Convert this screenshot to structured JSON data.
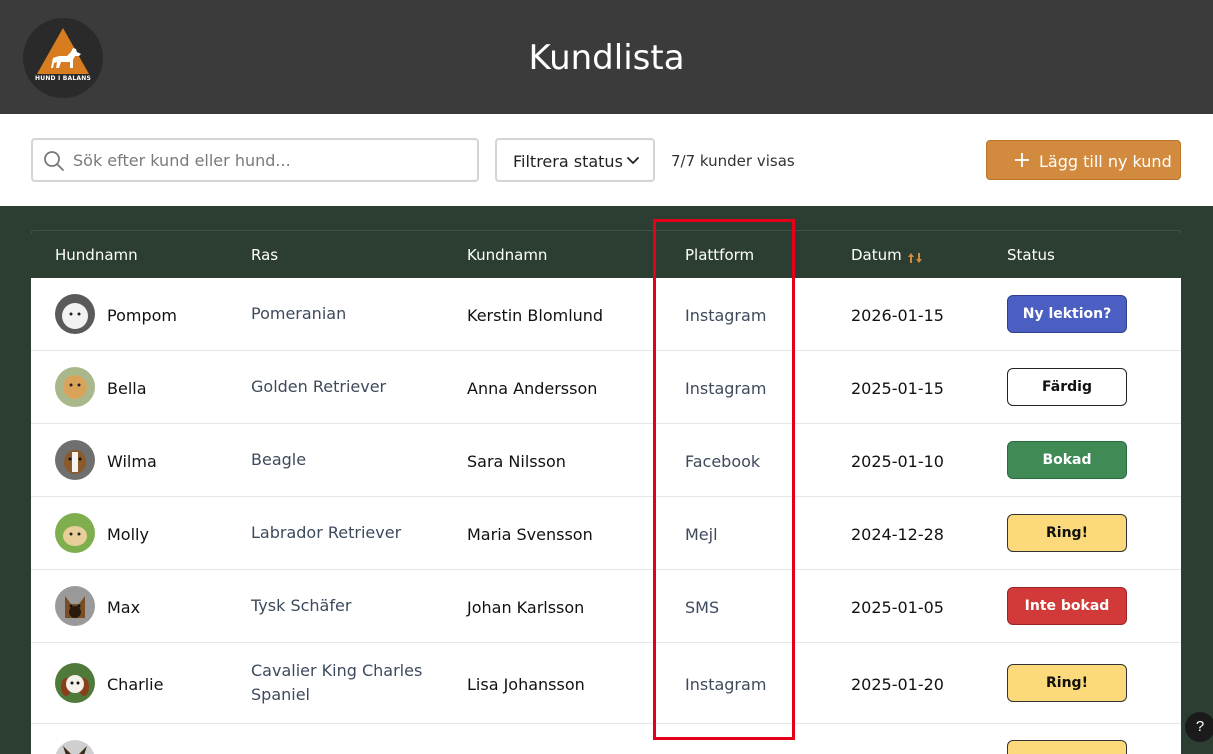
{
  "header": {
    "title": "Kundlista",
    "logo_text": "HUND I BALANS",
    "logo_icon": "dog-triangle-logo"
  },
  "toolbar": {
    "search_placeholder": "Sök efter kund eller hund...",
    "search_value": "",
    "filter_label": "Filtrera status",
    "count_text": "7/7 kunder visas",
    "add_label": "Lägg till ny kund"
  },
  "table": {
    "columns": [
      "Hundnamn",
      "Ras",
      "Kundnamn",
      "Plattform",
      "Datum",
      "Status"
    ],
    "rows": [
      {
        "dog": "Pompom",
        "breed": "Pomeranian",
        "owner": "Kerstin Blomlund",
        "platform": "Instagram",
        "date": "2026-01-15",
        "status": "Ny lektion?"
      },
      {
        "dog": "Bella",
        "breed": "Golden Retriever",
        "owner": "Anna Andersson",
        "platform": "Instagram",
        "date": "2025-01-15",
        "status": "Färdig"
      },
      {
        "dog": "Wilma",
        "breed": "Beagle",
        "owner": "Sara Nilsson",
        "platform": "Facebook",
        "date": "2025-01-10",
        "status": "Bokad"
      },
      {
        "dog": "Molly",
        "breed": "Labrador Retriever",
        "owner": "Maria Svensson",
        "platform": "Mejl",
        "date": "2024-12-28",
        "status": "Ring!"
      },
      {
        "dog": "Max",
        "breed": "Tysk Schäfer",
        "owner": "Johan Karlsson",
        "platform": "SMS",
        "date": "2025-01-05",
        "status": "Inte bokad"
      },
      {
        "dog": "Charlie",
        "breed": "Cavalier King Charles Spaniel",
        "owner": "Lisa Johansson",
        "platform": "Instagram",
        "date": "2025-01-20",
        "status": "Ring!"
      },
      {
        "dog": "",
        "breed": "",
        "owner": "",
        "platform": "",
        "date": "",
        "status": ""
      }
    ]
  },
  "status_colors": {
    "Ny lektion?": {
      "bg": "#4a5fc1",
      "fg": "#ffffff",
      "border": "#2f3f8f"
    },
    "Färdig": {
      "bg": "#ffffff",
      "fg": "#111111",
      "border": "#222222"
    },
    "Bokad": {
      "bg": "#3f8a55",
      "fg": "#ffffff",
      "border": "#2b6a3e"
    },
    "Ring!": {
      "bg": "#fcd97a",
      "fg": "#111111",
      "border": "#333333"
    },
    "Inte bokad": {
      "bg": "#d23a3a",
      "fg": "#ffffff",
      "border": "#9a2424"
    }
  },
  "colors": {
    "header_bg": "#3b3b3b",
    "table_header_bg": "#2c3e31",
    "accent": "#d28a3f",
    "highlight": "#e3001b"
  },
  "help_label": "?"
}
